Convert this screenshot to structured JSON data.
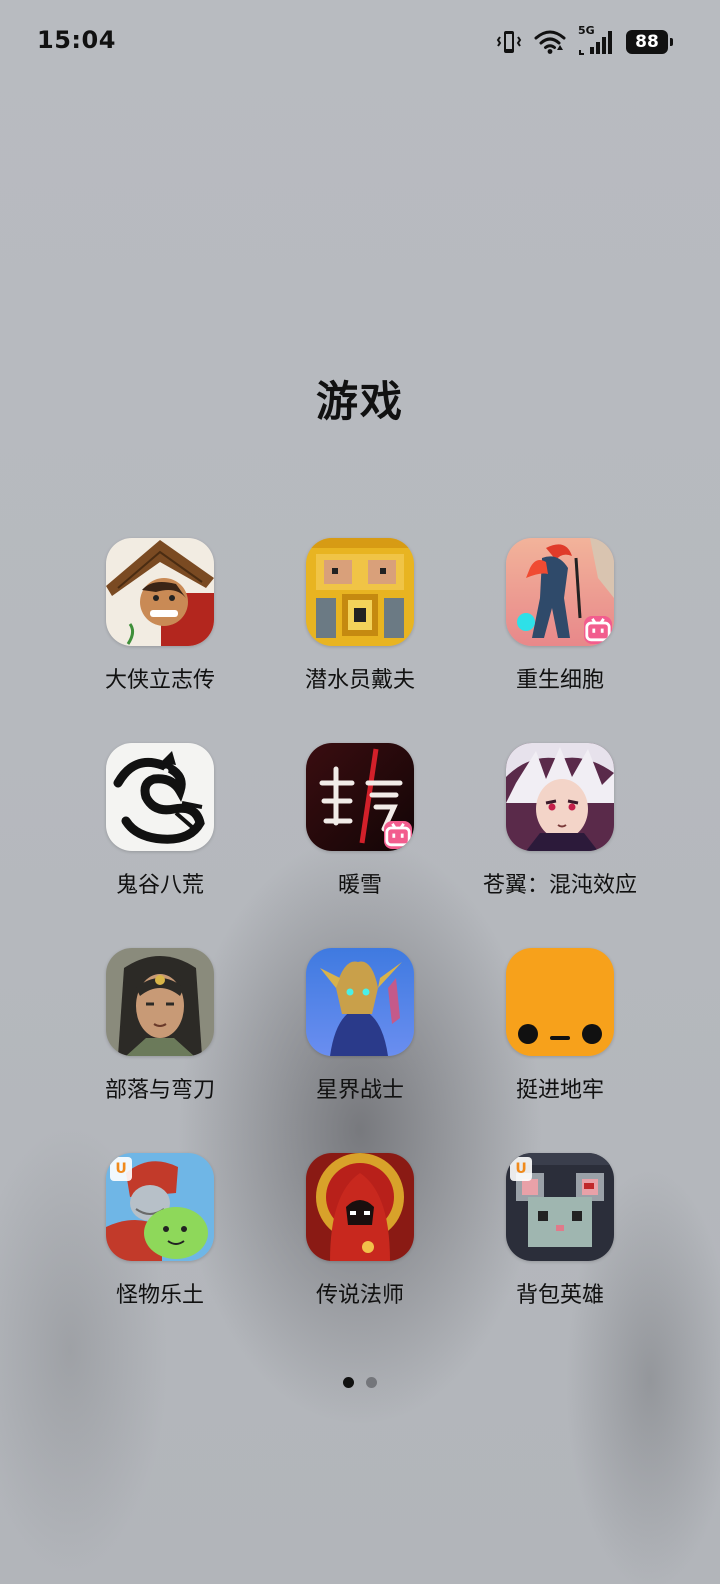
{
  "status_bar": {
    "time": "15:04",
    "network": "5G",
    "battery": "88",
    "icons": [
      "vibrate-icon",
      "wifi-icon",
      "cellular-5g-icon",
      "battery-icon"
    ]
  },
  "folder": {
    "title": "游戏"
  },
  "apps": [
    {
      "label": "大侠立志传",
      "icon": "wuxia-hero-icon"
    },
    {
      "label": "潜水员戴夫",
      "icon": "dave-the-diver-icon"
    },
    {
      "label": "重生细胞",
      "icon": "dead-cells-icon",
      "badge": "bilibili"
    },
    {
      "label": "鬼谷八荒",
      "icon": "tale-of-immortal-icon"
    },
    {
      "label": "暖雪",
      "icon": "warm-snow-icon",
      "badge": "bilibili"
    },
    {
      "label": "苍翼：混沌效应",
      "icon": "blazblue-entropy-effect-icon"
    },
    {
      "label": "部落与弯刀",
      "icon": "tribes-and-blades-icon"
    },
    {
      "label": "星界战士",
      "icon": "astral-warrior-icon"
    },
    {
      "label": "挺进地牢",
      "icon": "enter-the-gungeon-icon"
    },
    {
      "label": "怪物乐土",
      "icon": "monster-land-icon",
      "badge": "u"
    },
    {
      "label": "传说法师",
      "icon": "wizard-of-legend-icon"
    },
    {
      "label": "背包英雄",
      "icon": "backpack-hero-icon",
      "badge": "u"
    }
  ],
  "pagination": {
    "pages": 2,
    "active": 1
  },
  "colors": {
    "background": "#b8bbc0",
    "text": "#111111",
    "bilibili_badge": "#f25d8e",
    "orange_app": "#f7a11b"
  }
}
